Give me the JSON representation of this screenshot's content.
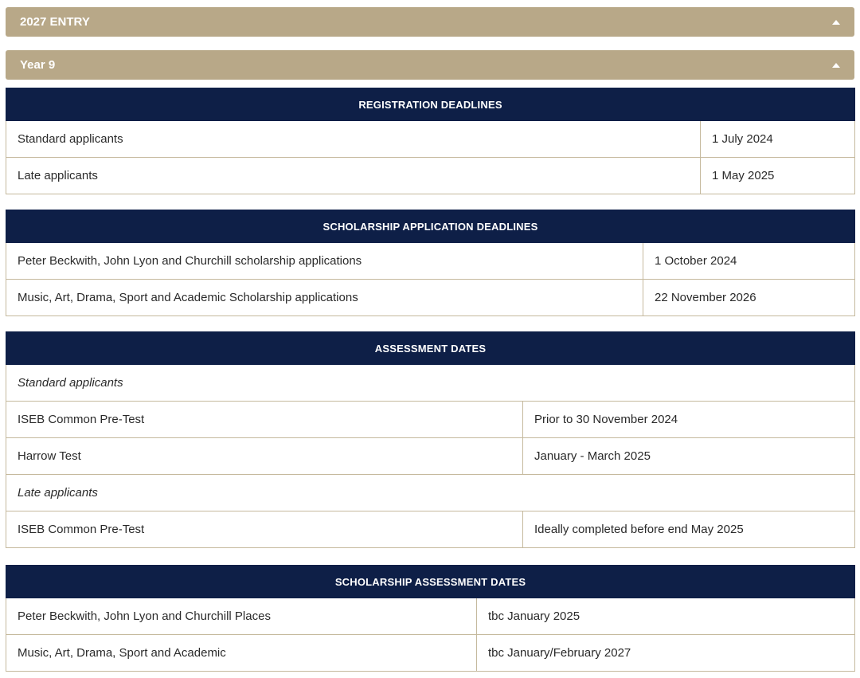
{
  "accordions": {
    "entry": "2027 ENTRY",
    "year": "Year 9"
  },
  "registration": {
    "title": "REGISTRATION DEADLINES",
    "rows": [
      {
        "label": "Standard applicants",
        "value": "1 July 2024"
      },
      {
        "label": "Late applicants",
        "value": "1 May 2025"
      }
    ]
  },
  "scholarship_application": {
    "title": "SCHOLARSHIP APPLICATION DEADLINES",
    "rows": [
      {
        "label": "Peter Beckwith, John Lyon and Churchill scholarship applications",
        "value": "1 October 2024"
      },
      {
        "label": "Music, Art, Drama, Sport and Academic Scholarship applications",
        "value": "22 November 2026"
      }
    ]
  },
  "assessment": {
    "title": "ASSESSMENT DATES",
    "standard_heading": "Standard applicants",
    "standard_rows": [
      {
        "label": "ISEB Common Pre-Test",
        "value": "Prior to 30 November 2024"
      },
      {
        "label": "Harrow Test",
        "value": "January - March 2025"
      }
    ],
    "late_heading": "Late applicants",
    "late_rows": [
      {
        "label": "ISEB Common Pre-Test",
        "value": "Ideally completed before end May 2025"
      }
    ]
  },
  "scholarship_assessment": {
    "title": "SCHOLARSHIP ASSESSMENT DATES",
    "rows": [
      {
        "label": "Peter Beckwith, John Lyon and Churchill Places",
        "value": "tbc January 2025"
      },
      {
        "label": "Music, Art, Drama, Sport and Academic",
        "value": "tbc January/February 2027"
      }
    ]
  },
  "colors": {
    "accordion_bg": "#b8a888",
    "header_bg": "#0e1f47",
    "border": "#c5b99d"
  }
}
